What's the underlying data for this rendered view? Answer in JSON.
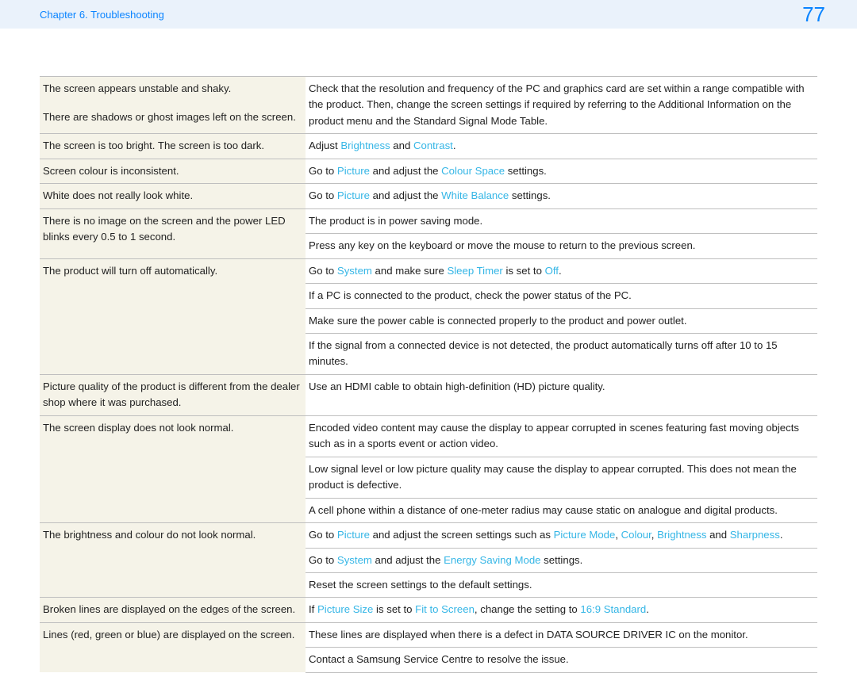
{
  "header": {
    "chapter": "Chapter 6. Troubleshooting",
    "page": "77"
  },
  "rows": [
    {
      "sym": "The screen appears unstable and shaky.",
      "sol": [
        {
          "t": "Check that the resolution and frequency of the PC and graphics card are set within a range compatible with the product. Then, change the screen settings if required by referring to the Additional Information on the product menu and the Standard Signal Mode Table."
        }
      ],
      "rowspan": 2
    },
    {
      "sym": "There are shadows or ghost images left on the screen.",
      "merge": true,
      "symNoBorder": true
    },
    {
      "sym": "The screen is too bright. The screen is too dark.",
      "sol": [
        {
          "t": "Adjust "
        },
        {
          "t": "Brightness",
          "l": 1
        },
        {
          "t": " and "
        },
        {
          "t": "Contrast",
          "l": 1
        },
        {
          "t": "."
        }
      ]
    },
    {
      "sym": "Screen colour is inconsistent.",
      "sol": [
        {
          "t": "Go to "
        },
        {
          "t": "Picture",
          "l": 1
        },
        {
          "t": " and adjust the "
        },
        {
          "t": "Colour Space",
          "l": 1
        },
        {
          "t": " settings."
        }
      ]
    },
    {
      "sym": "White does not really look white.",
      "sol": [
        {
          "t": "Go to "
        },
        {
          "t": "Picture",
          "l": 1
        },
        {
          "t": " and adjust the "
        },
        {
          "t": "White Balance",
          "l": 1
        },
        {
          "t": " settings."
        }
      ]
    },
    {
      "sym": "There is no image on the screen and the power LED blinks every 0.5 to 1 second.",
      "sol": [
        {
          "t": "The product is in power saving mode."
        }
      ],
      "extra": [
        [
          {
            "t": "Press any key on the keyboard or move the mouse to return to the previous screen."
          }
        ]
      ]
    },
    {
      "sym": "The product will turn off automatically.",
      "sol": [
        {
          "t": "Go to "
        },
        {
          "t": "System",
          "l": 1
        },
        {
          "t": " and make sure "
        },
        {
          "t": "Sleep Timer",
          "l": 1
        },
        {
          "t": " is set to "
        },
        {
          "t": "Off",
          "l": 1
        },
        {
          "t": "."
        }
      ],
      "extra": [
        [
          {
            "t": "If a PC is connected to the product, check the power status of the PC."
          }
        ],
        [
          {
            "t": "Make sure the power cable is connected properly to the product and power outlet."
          }
        ],
        [
          {
            "t": "If the signal from a connected device is not detected, the product automatically turns off after 10 to 15 minutes."
          }
        ]
      ]
    },
    {
      "sym": "Picture quality of the product is different from the dealer shop where it was purchased.",
      "sol": [
        {
          "t": "Use an HDMI cable to obtain high-definition (HD) picture quality."
        }
      ]
    },
    {
      "sym": "The screen display does not look normal.",
      "sol": [
        {
          "t": "Encoded video content may cause the display to appear corrupted in scenes featuring fast moving objects such as in a sports event or action video."
        }
      ],
      "extra": [
        [
          {
            "t": "Low signal level or low picture quality may cause the display to appear corrupted. This does not mean the product is defective."
          }
        ],
        [
          {
            "t": "A cell phone within a distance of one-meter radius may cause static on analogue and digital products."
          }
        ]
      ]
    },
    {
      "sym": "The brightness and colour do not look normal.",
      "sol": [
        {
          "t": "Go to "
        },
        {
          "t": "Picture",
          "l": 1
        },
        {
          "t": " and adjust the screen settings such as "
        },
        {
          "t": "Picture Mode",
          "l": 1
        },
        {
          "t": ", "
        },
        {
          "t": "Colour",
          "l": 1
        },
        {
          "t": ", "
        },
        {
          "t": "Brightness",
          "l": 1
        },
        {
          "t": " and "
        },
        {
          "t": "Sharpness",
          "l": 1
        },
        {
          "t": "."
        }
      ],
      "extra": [
        [
          {
            "t": "Go to "
          },
          {
            "t": "System",
            "l": 1
          },
          {
            "t": " and adjust the "
          },
          {
            "t": "Energy Saving Mode",
            "l": 1
          },
          {
            "t": " settings."
          }
        ],
        [
          {
            "t": "Reset the screen settings to the default settings."
          }
        ]
      ]
    },
    {
      "sym": "Broken lines are displayed on the edges of the screen.",
      "sol": [
        {
          "t": "If "
        },
        {
          "t": "Picture Size",
          "l": 1
        },
        {
          "t": " is set to "
        },
        {
          "t": "Fit to Screen",
          "l": 1
        },
        {
          "t": ", change the setting to "
        },
        {
          "t": "16:9 Standard",
          "l": 1
        },
        {
          "t": "."
        }
      ]
    },
    {
      "sym": "Lines (red, green or blue) are displayed on the screen.",
      "sol": [
        {
          "t": "These lines are displayed when there is a defect in DATA SOURCE DRIVER IC on the monitor."
        }
      ],
      "extra": [
        [
          {
            "t": "Contact a Samsung Service Centre to resolve the issue."
          }
        ]
      ],
      "last": true
    }
  ]
}
